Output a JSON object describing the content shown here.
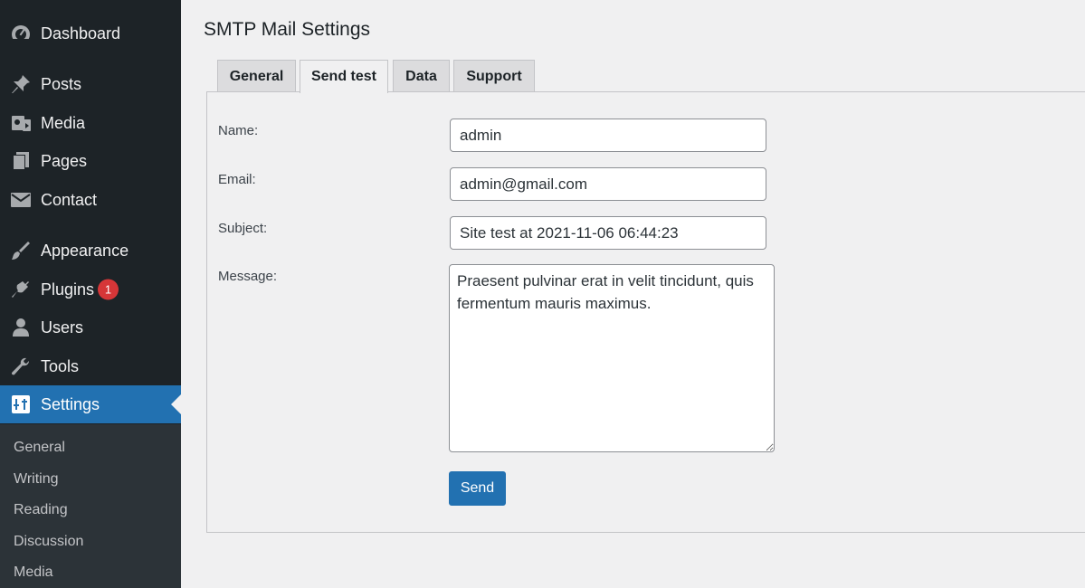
{
  "sidebar": {
    "items": [
      {
        "label": "Dashboard",
        "icon": "dashboard-icon"
      },
      {
        "label": "Posts",
        "icon": "pin-icon"
      },
      {
        "label": "Media",
        "icon": "media-icon"
      },
      {
        "label": "Pages",
        "icon": "pages-icon"
      },
      {
        "label": "Contact",
        "icon": "envelope-icon"
      },
      {
        "label": "Appearance",
        "icon": "paintbrush-icon"
      },
      {
        "label": "Plugins",
        "icon": "plug-icon",
        "badge": "1"
      },
      {
        "label": "Users",
        "icon": "user-icon"
      },
      {
        "label": "Tools",
        "icon": "wrench-icon"
      },
      {
        "label": "Settings",
        "icon": "settings-icon",
        "active": true
      }
    ],
    "submenu": [
      "General",
      "Writing",
      "Reading",
      "Discussion",
      "Media"
    ]
  },
  "main": {
    "title": "SMTP Mail Settings",
    "tabs": [
      {
        "label": "General",
        "active": false
      },
      {
        "label": "Send test",
        "active": true
      },
      {
        "label": "Data",
        "active": false
      },
      {
        "label": "Support",
        "active": false
      }
    ],
    "form": {
      "name_label": "Name:",
      "name_value": "admin",
      "email_label": "Email:",
      "email_value": "admin@gmail.com",
      "subject_label": "Subject:",
      "subject_value": "Site test at 2021-11-06 06:44:23",
      "message_label": "Message:",
      "message_value": "Praesent pulvinar erat in velit tincidunt, quis fermentum mauris maximus.",
      "send_label": "Send"
    }
  },
  "colors": {
    "sidebar_bg": "#1d2327",
    "submenu_bg": "#2c3338",
    "accent": "#2271b1",
    "badge": "#d63638",
    "page_bg": "#f0f0f1"
  }
}
